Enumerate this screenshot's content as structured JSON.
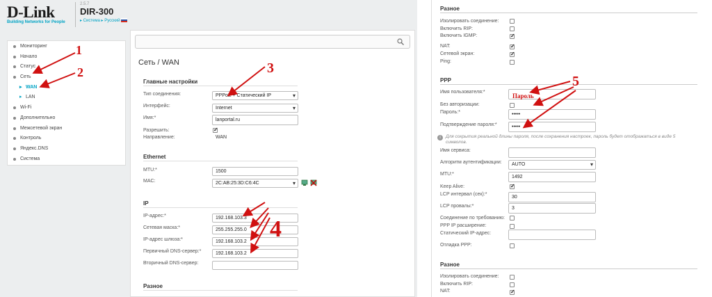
{
  "header": {
    "logo": "D-Link",
    "tagline": "Building Networks for People",
    "firmware": "2.5.7",
    "model": "DIR-300",
    "crumb_system": "▸ Система",
    "crumb_lang": "▸ Русский"
  },
  "nav": {
    "items": [
      {
        "label": "Мониторинг"
      },
      {
        "label": "Начало"
      },
      {
        "label": "Статус"
      },
      {
        "label": "Сеть"
      },
      {
        "label": "WAN"
      },
      {
        "label": "LAN"
      },
      {
        "label": "Wi-Fi"
      },
      {
        "label": "Дополнительно"
      },
      {
        "label": "Межсетевой экран"
      },
      {
        "label": "Контроль"
      },
      {
        "label": "Яндекс.DNS"
      },
      {
        "label": "Система"
      }
    ]
  },
  "main": {
    "search_placeholder": "",
    "title": "Сеть /  WAN",
    "general": {
      "heading": "Главные настройки",
      "conn_type_label": "Тип соединения:",
      "conn_type_value": "PPPoE + Статический IP",
      "iface_label": "Интерфейс:",
      "iface_value": "Internet",
      "name_label": "Имя:*",
      "name_value": "lanportal.ru",
      "allow_label": "Разрешить:",
      "dir_label": "Направление:",
      "dir_value": "WAN"
    },
    "ethernet": {
      "heading": "Ethernet",
      "mtu_label": "MTU:*",
      "mtu_value": "1500",
      "mac_label": "MAC:",
      "mac_value": "2C:AB:25:3D:C6:4C"
    },
    "ip": {
      "heading": "IP",
      "ip_label": "IP-адрес:*",
      "ip_value": "192.168.103.3",
      "mask_label": "Сетевая маска:*",
      "mask_value": "255.255.255.0",
      "gw_label": "IP-адрес шлюза:*",
      "gw_value": "192.168.103.2",
      "dns1_label": "Первичный DNS-сервер:*",
      "dns1_value": "192.168.103.2",
      "dns2_label": "Вторичный DNS-сервер:",
      "dns2_value": ""
    },
    "misc_heading": "Разное"
  },
  "right": {
    "misc": {
      "heading": "Разное",
      "isolate": "Изолировать соединение:",
      "rip": "Включить RIP:",
      "igmp": "Включить IGMP:",
      "nat": "NAT:",
      "firewall": "Сетевой экран:",
      "ping": "Ping:"
    },
    "ppp": {
      "heading": "PPP",
      "user_label": "Имя пользователя:*",
      "user_value": "",
      "noauth_label": "Без авторизации:",
      "pass_label": "Пароль:*",
      "pass_value": "•••••",
      "confirm_label": "Подтверждение пароля:*",
      "confirm_value": "•••••",
      "note": "Для сокрытия реальной длины пароля, после сохранения настроек, пароль будет отображаться в виде 5 символов.",
      "service_label": "Имя сервиса:",
      "auth_label": "Алгоритм аутентификации:",
      "auth_value": "AUTO",
      "mtu_label": "MTU:*",
      "mtu_value": "1492",
      "keepalive_label": "Keep Alive:",
      "lcp_int_label": "LCP интервал (сек):*",
      "lcp_int_value": "30",
      "lcp_fail_label": "LCP провалы:*",
      "lcp_fail_value": "3",
      "ondemand_label": "Соединение по требованию:",
      "pppip_label": "PPP IP расширение:",
      "staticip_label": "Статический IP-адрес:",
      "debug_label": "Отладка PPP:"
    },
    "misc2": {
      "heading": "Разное",
      "isolate": "Изолировать соединение:",
      "rip": "Включить RIP:",
      "nat": "NAT:"
    }
  },
  "annotations": {
    "n1": "1",
    "n2": "2",
    "n3": "3",
    "n4": "4",
    "n5": "5",
    "password_hint": "Пароль",
    "color": "#d01010"
  }
}
